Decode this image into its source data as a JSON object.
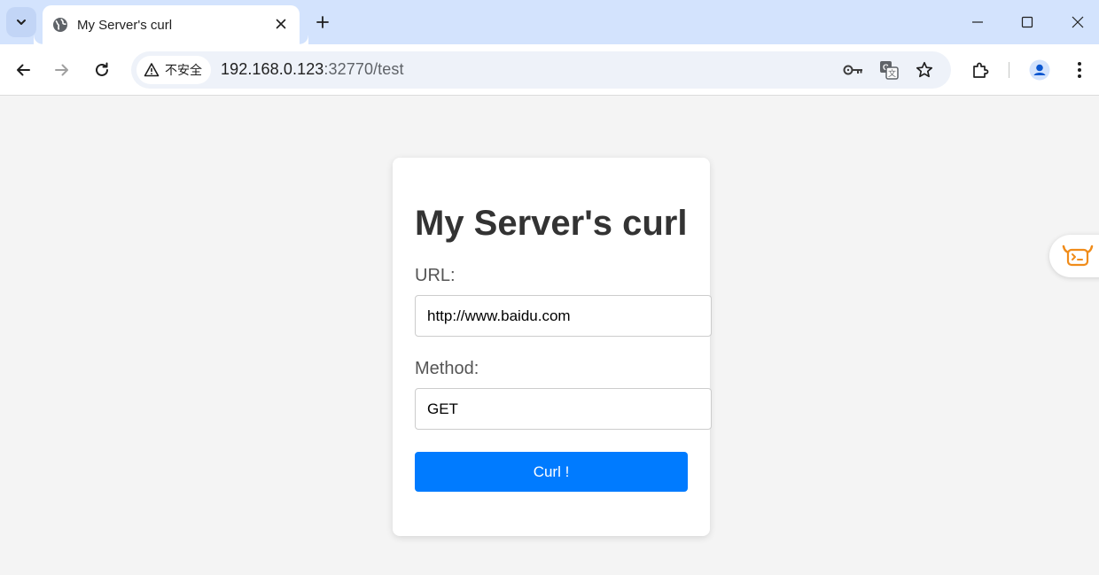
{
  "browser": {
    "tab": {
      "title": "My Server's curl",
      "icon": "globe-icon"
    },
    "address_bar": {
      "security_label": "不安全",
      "url_host": "192.168.0.123",
      "url_rest": ":32770/test"
    }
  },
  "page": {
    "title": "My Server's curl",
    "url_label": "URL:",
    "url_value": "http://www.baidu.com",
    "method_label": "Method:",
    "method_value": "GET",
    "submit_label": "Curl !"
  },
  "colors": {
    "accent": "#007bff",
    "tabstrip": "#d3e3fd",
    "page_background": "#f4f4f4",
    "widget": "#f08c1a"
  }
}
